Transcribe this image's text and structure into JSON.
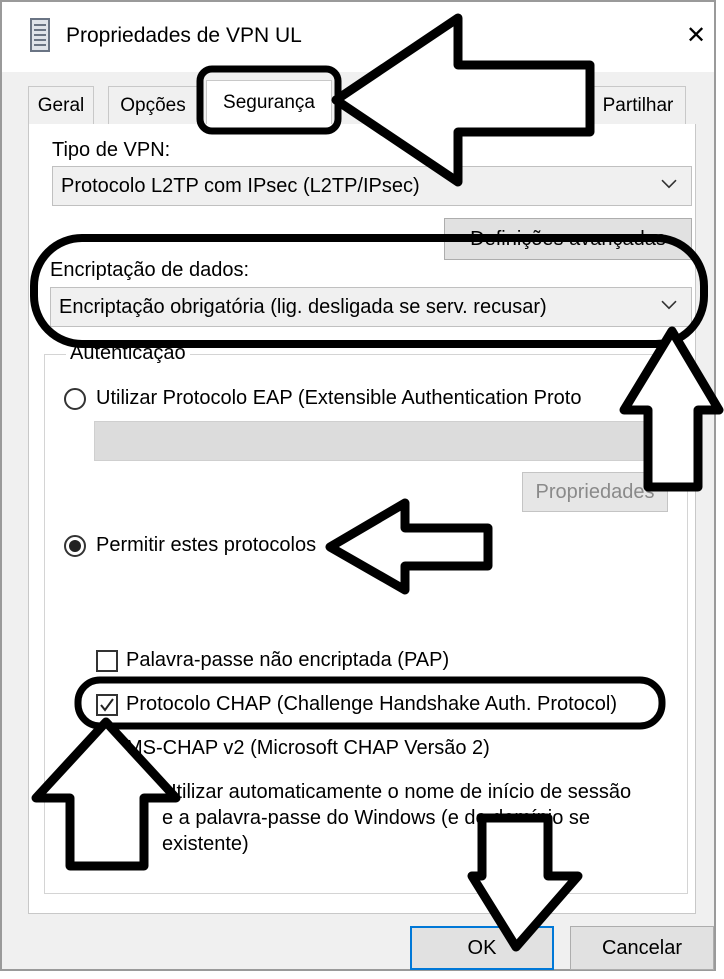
{
  "window": {
    "title": "Propriedades de VPN UL",
    "close_glyph": "✕"
  },
  "tabs": [
    {
      "label": "Geral"
    },
    {
      "label": "Opções"
    },
    {
      "label": "Segurança"
    },
    {
      "label": "Partilhar"
    }
  ],
  "vpn_type": {
    "label": "Tipo de VPN:",
    "value": "Protocolo L2TP com IPsec (L2TP/IPsec)",
    "advanced_button": "Definições avançadas"
  },
  "encryption": {
    "label": "Encriptação de dados:",
    "value": "Encriptação obrigatória (lig. desligada se serv. recusar)"
  },
  "authentication": {
    "group_label": "Autenticação",
    "eap_option": "Utilizar Protocolo EAP (Extensible Authentication Proto",
    "properties_button": "Propriedades",
    "allow_option": "Permitir estes protocolos",
    "pap_label": "Palavra-passe não encriptada (PAP)",
    "chap_label": "Protocolo CHAP (Challenge Handshake Auth. Protocol)",
    "mschap_label": "MS-CHAP v2 (Microsoft CHAP Versão 2)",
    "windows_line1": "Utilizar automaticamente o nome de início de sessão",
    "windows_line2": "e a palavra-passe do Windows (e do domínio se",
    "windows_line3": "existente)"
  },
  "footer": {
    "ok_label": "OK",
    "cancel_label": "Cancelar"
  },
  "state": {
    "eap_selected": false,
    "allow_selected": true,
    "pap_checked": false,
    "chap_checked": true
  },
  "colors": {
    "dialog_bg": "#f0f0f0",
    "panel_bg": "#ffffff",
    "annotation": "#000000"
  },
  "icons": {
    "window_icon": "document-icon",
    "close": "close-icon",
    "chevron": "chevron-down-icon",
    "annotation_arrow": "arrow-icon"
  }
}
